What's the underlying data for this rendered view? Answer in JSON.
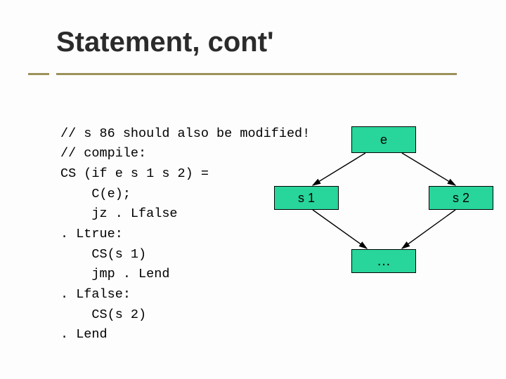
{
  "title": "Statement, cont'",
  "code_lines": [
    "// s 86 should also be modified!",
    "// compile:",
    "CS (if e s 1 s 2) =",
    "    C(e);",
    "    jz . Lfalse",
    ". Ltrue:",
    "    CS(s 1)",
    "    jmp . Lend",
    ". Lfalse:",
    "    CS(s 2)",
    ". Lend"
  ],
  "diagram": {
    "e": "e",
    "s1": "s 1",
    "s2": "s 2",
    "merge": "…"
  },
  "colors": {
    "node_fill": "#28d59a",
    "accent": "#9b915a"
  }
}
